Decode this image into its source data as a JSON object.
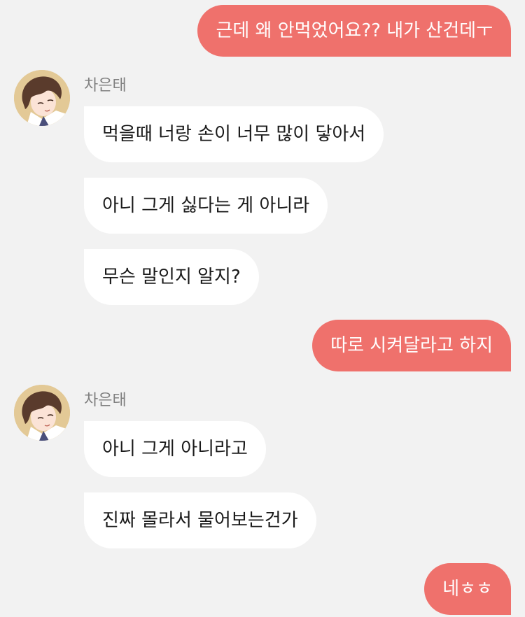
{
  "conversation": {
    "sender_name": "차은태",
    "avatar_icon": "boy-portrait-avatar",
    "colors": {
      "background": "#f2f2f2",
      "outgoing_bubble": "#ef716c",
      "incoming_bubble": "#ffffff",
      "sender_name": "#808080"
    },
    "messages": [
      {
        "direction": "out",
        "text": "근데 왜 안먹었어요?? 내가 산건데ㅜ"
      },
      {
        "direction": "in",
        "text": "먹을때 너랑 손이 너무 많이 닿아서"
      },
      {
        "direction": "in",
        "text": "아니 그게 싫다는 게 아니라"
      },
      {
        "direction": "in",
        "text": "무슨 말인지 알지?"
      },
      {
        "direction": "out",
        "text": "따로 시켜달라고 하지"
      },
      {
        "direction": "in",
        "text": "아니 그게 아니라고"
      },
      {
        "direction": "in",
        "text": "진짜 몰라서 물어보는건가"
      },
      {
        "direction": "out",
        "text": "네ㅎㅎ"
      }
    ]
  }
}
